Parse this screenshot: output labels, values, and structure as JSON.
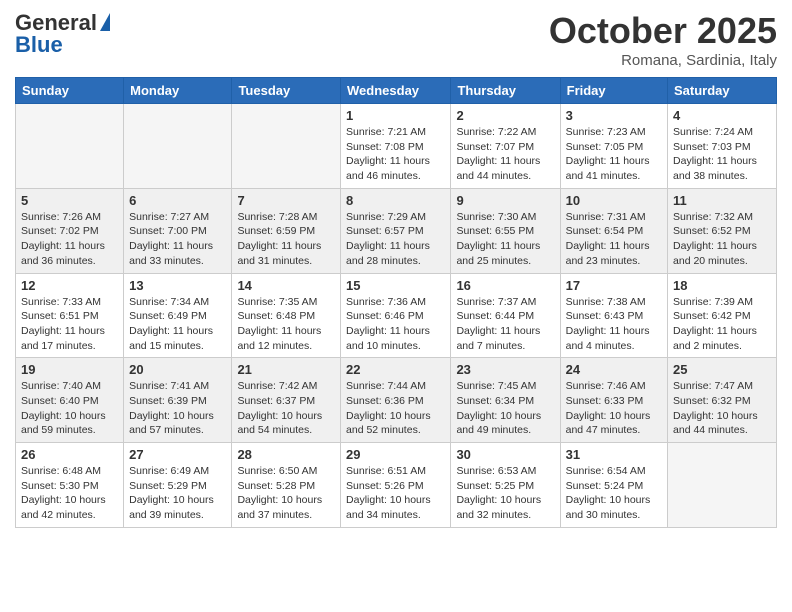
{
  "header": {
    "logo_general": "General",
    "logo_blue": "Blue",
    "month": "October 2025",
    "location": "Romana, Sardinia, Italy"
  },
  "days_of_week": [
    "Sunday",
    "Monday",
    "Tuesday",
    "Wednesday",
    "Thursday",
    "Friday",
    "Saturday"
  ],
  "weeks": [
    [
      {
        "day": "",
        "info": ""
      },
      {
        "day": "",
        "info": ""
      },
      {
        "day": "",
        "info": ""
      },
      {
        "day": "1",
        "info": "Sunrise: 7:21 AM\nSunset: 7:08 PM\nDaylight: 11 hours and 46 minutes."
      },
      {
        "day": "2",
        "info": "Sunrise: 7:22 AM\nSunset: 7:07 PM\nDaylight: 11 hours and 44 minutes."
      },
      {
        "day": "3",
        "info": "Sunrise: 7:23 AM\nSunset: 7:05 PM\nDaylight: 11 hours and 41 minutes."
      },
      {
        "day": "4",
        "info": "Sunrise: 7:24 AM\nSunset: 7:03 PM\nDaylight: 11 hours and 38 minutes."
      }
    ],
    [
      {
        "day": "5",
        "info": "Sunrise: 7:26 AM\nSunset: 7:02 PM\nDaylight: 11 hours and 36 minutes."
      },
      {
        "day": "6",
        "info": "Sunrise: 7:27 AM\nSunset: 7:00 PM\nDaylight: 11 hours and 33 minutes."
      },
      {
        "day": "7",
        "info": "Sunrise: 7:28 AM\nSunset: 6:59 PM\nDaylight: 11 hours and 31 minutes."
      },
      {
        "day": "8",
        "info": "Sunrise: 7:29 AM\nSunset: 6:57 PM\nDaylight: 11 hours and 28 minutes."
      },
      {
        "day": "9",
        "info": "Sunrise: 7:30 AM\nSunset: 6:55 PM\nDaylight: 11 hours and 25 minutes."
      },
      {
        "day": "10",
        "info": "Sunrise: 7:31 AM\nSunset: 6:54 PM\nDaylight: 11 hours and 23 minutes."
      },
      {
        "day": "11",
        "info": "Sunrise: 7:32 AM\nSunset: 6:52 PM\nDaylight: 11 hours and 20 minutes."
      }
    ],
    [
      {
        "day": "12",
        "info": "Sunrise: 7:33 AM\nSunset: 6:51 PM\nDaylight: 11 hours and 17 minutes."
      },
      {
        "day": "13",
        "info": "Sunrise: 7:34 AM\nSunset: 6:49 PM\nDaylight: 11 hours and 15 minutes."
      },
      {
        "day": "14",
        "info": "Sunrise: 7:35 AM\nSunset: 6:48 PM\nDaylight: 11 hours and 12 minutes."
      },
      {
        "day": "15",
        "info": "Sunrise: 7:36 AM\nSunset: 6:46 PM\nDaylight: 11 hours and 10 minutes."
      },
      {
        "day": "16",
        "info": "Sunrise: 7:37 AM\nSunset: 6:44 PM\nDaylight: 11 hours and 7 minutes."
      },
      {
        "day": "17",
        "info": "Sunrise: 7:38 AM\nSunset: 6:43 PM\nDaylight: 11 hours and 4 minutes."
      },
      {
        "day": "18",
        "info": "Sunrise: 7:39 AM\nSunset: 6:42 PM\nDaylight: 11 hours and 2 minutes."
      }
    ],
    [
      {
        "day": "19",
        "info": "Sunrise: 7:40 AM\nSunset: 6:40 PM\nDaylight: 10 hours and 59 minutes."
      },
      {
        "day": "20",
        "info": "Sunrise: 7:41 AM\nSunset: 6:39 PM\nDaylight: 10 hours and 57 minutes."
      },
      {
        "day": "21",
        "info": "Sunrise: 7:42 AM\nSunset: 6:37 PM\nDaylight: 10 hours and 54 minutes."
      },
      {
        "day": "22",
        "info": "Sunrise: 7:44 AM\nSunset: 6:36 PM\nDaylight: 10 hours and 52 minutes."
      },
      {
        "day": "23",
        "info": "Sunrise: 7:45 AM\nSunset: 6:34 PM\nDaylight: 10 hours and 49 minutes."
      },
      {
        "day": "24",
        "info": "Sunrise: 7:46 AM\nSunset: 6:33 PM\nDaylight: 10 hours and 47 minutes."
      },
      {
        "day": "25",
        "info": "Sunrise: 7:47 AM\nSunset: 6:32 PM\nDaylight: 10 hours and 44 minutes."
      }
    ],
    [
      {
        "day": "26",
        "info": "Sunrise: 6:48 AM\nSunset: 5:30 PM\nDaylight: 10 hours and 42 minutes."
      },
      {
        "day": "27",
        "info": "Sunrise: 6:49 AM\nSunset: 5:29 PM\nDaylight: 10 hours and 39 minutes."
      },
      {
        "day": "28",
        "info": "Sunrise: 6:50 AM\nSunset: 5:28 PM\nDaylight: 10 hours and 37 minutes."
      },
      {
        "day": "29",
        "info": "Sunrise: 6:51 AM\nSunset: 5:26 PM\nDaylight: 10 hours and 34 minutes."
      },
      {
        "day": "30",
        "info": "Sunrise: 6:53 AM\nSunset: 5:25 PM\nDaylight: 10 hours and 32 minutes."
      },
      {
        "day": "31",
        "info": "Sunrise: 6:54 AM\nSunset: 5:24 PM\nDaylight: 10 hours and 30 minutes."
      },
      {
        "day": "",
        "info": ""
      }
    ]
  ]
}
